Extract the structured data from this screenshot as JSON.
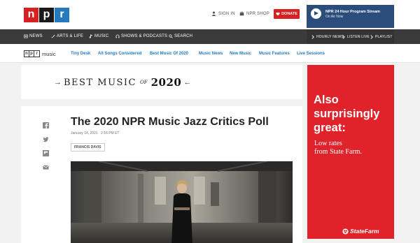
{
  "logo": {
    "letters": [
      "n",
      "p",
      "r"
    ]
  },
  "header": {
    "sign_in": "SIGN IN",
    "npr_shop": "NPR SHOP",
    "donate": "DONATE",
    "stream_title": "NPR 24 Hour Program Stream",
    "stream_status": "On Air Now"
  },
  "nav": {
    "items": [
      "NEWS",
      "ARTS & LIFE",
      "MUSIC",
      "SHOWS & PODCASTS",
      "SEARCH"
    ],
    "right_items": [
      "HOURLY NEWS",
      "LISTEN LIVE",
      "PLAYLIST"
    ]
  },
  "music_nav": {
    "logo_letters": [
      "n",
      "p",
      "r"
    ],
    "logo_word": "music",
    "links": [
      "Tiny Desk",
      "All Songs Considered",
      "Best Music Of 2020",
      "Music News",
      "New Music",
      "Music Features",
      "Live Sessions"
    ]
  },
  "banner": {
    "best": "BEST MUSIC",
    "of": "OF",
    "year": "2020"
  },
  "article": {
    "title": "The 2020 NPR Music Jazz Critics Poll",
    "dateline": "January 14, 2021 · 2:16 PM ET",
    "author": "FRANCIS DAVIS"
  },
  "ad": {
    "headline": "Also surprisingly great:",
    "subline1": "Low rates",
    "subline2": "from State Farm.",
    "brand": "StateFarm"
  },
  "colors": {
    "npr_red": "#d62021",
    "npr_blue": "#237bbd",
    "nav_dark": "#3b3b3b",
    "stream_blue": "#2b4d7c",
    "ad_red": "#e0232a"
  }
}
